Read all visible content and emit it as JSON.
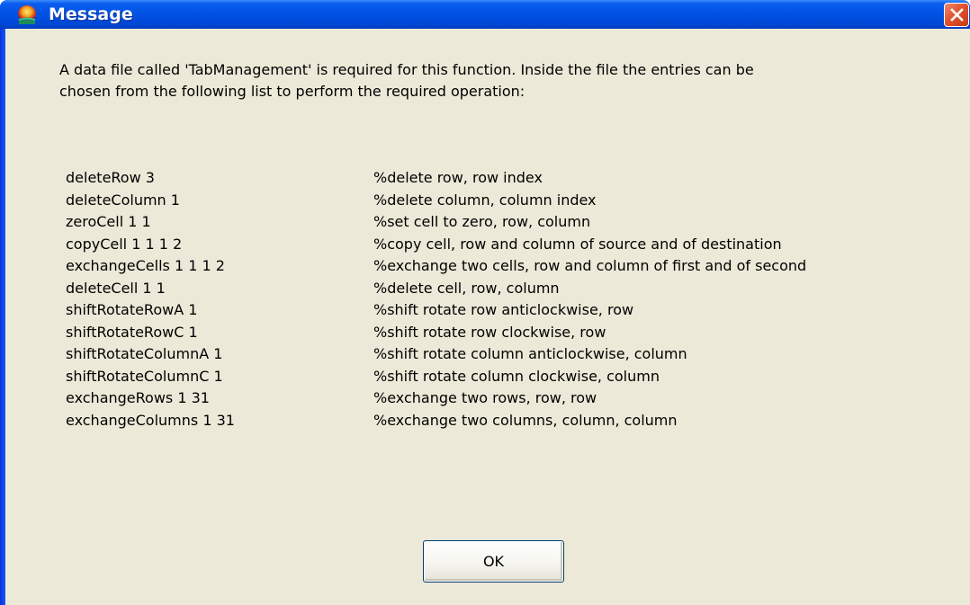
{
  "window": {
    "title": "Message",
    "icon": "app-icon",
    "close_icon": "close-icon"
  },
  "message": {
    "intro_line1": "A data file called 'TabManagement' is required for this function. Inside the file the entries can be",
    "intro_line2": "chosen from the following list to perform the required operation:",
    "commands": [
      {
        "name": "deleteRow 3",
        "desc": "%delete row, row index"
      },
      {
        "name": "deleteColumn 1",
        "desc": "%delete column, column index"
      },
      {
        "name": "zeroCell 1 1",
        "desc": "%set cell to zero, row, column"
      },
      {
        "name": "copyCell 1 1 1 2",
        "desc": "%copy cell, row and column of source and of destination"
      },
      {
        "name": "exchangeCells 1 1 1 2",
        "desc": "%exchange two cells, row and column of first and of second"
      },
      {
        "name": "deleteCell 1 1",
        "desc": "%delete cell, row, column"
      },
      {
        "name": "shiftRotateRowA 1",
        "desc": "%shift rotate row anticlockwise, row"
      },
      {
        "name": "shiftRotateRowC 1",
        "desc": "%shift rotate row clockwise, row"
      },
      {
        "name": "shiftRotateColumnA 1",
        "desc": "%shift rotate column anticlockwise, column"
      },
      {
        "name": "shiftRotateColumnC 1",
        "desc": "%shift rotate column clockwise, column"
      },
      {
        "name": "exchangeRows 1 31",
        "desc": "%exchange two rows, row, row"
      },
      {
        "name": "exchangeColumns 1 31",
        "desc": "%exchange two columns, column, column"
      }
    ]
  },
  "buttons": {
    "ok_label": "OK"
  },
  "colors": {
    "titlebar": "#0052e4",
    "client_background": "#ece9d8",
    "close_button": "#e2522f"
  }
}
